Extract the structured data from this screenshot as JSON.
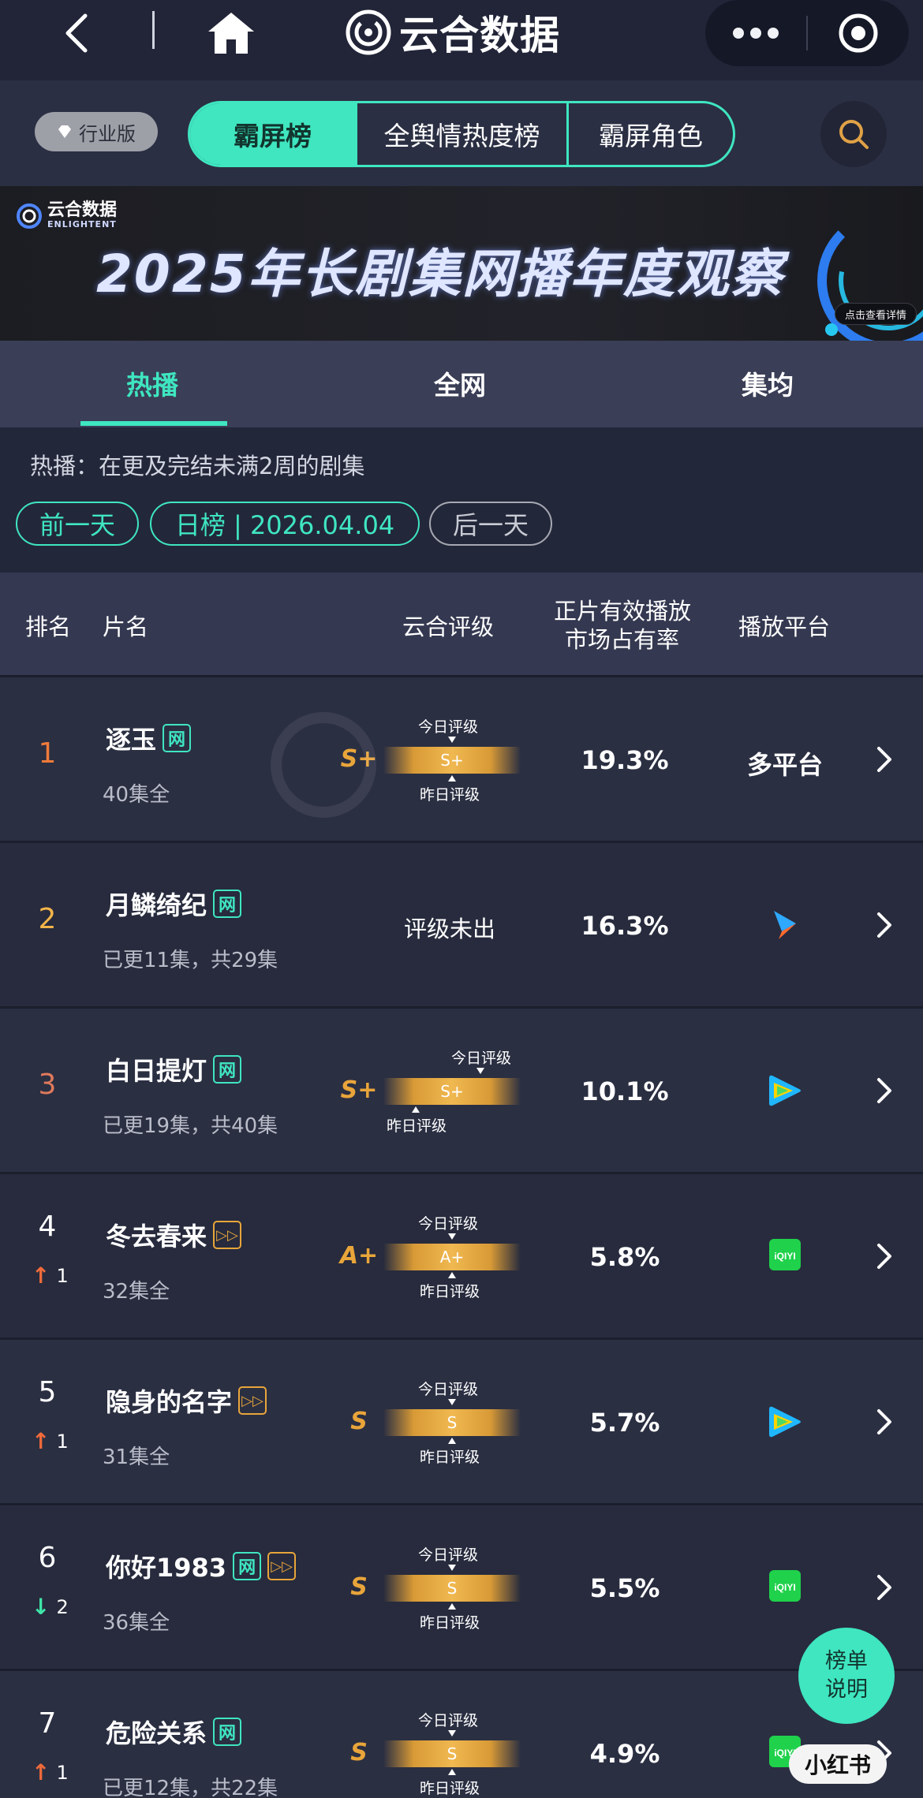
{
  "topbar": {
    "app_title": "云合数据"
  },
  "subnav": {
    "industry_badge": "行业版",
    "segments": [
      "霸屏榜",
      "全舆情热度榜",
      "霸屏角色"
    ],
    "active_segment": 0
  },
  "banner": {
    "logo_text": "云合数据",
    "logo_sub": "ENLIGHTENT",
    "headline": "2025年长剧集网播年度观察",
    "detail_button": "点击查看详情",
    "accent": "#2d7cf0"
  },
  "tabs": [
    "热播",
    "全网",
    "集均"
  ],
  "description": "热播：在更及完结未满2周的剧集",
  "date_nav": {
    "prev": "前一天",
    "current": "日榜 | 2026.04.04",
    "next": "后一天"
  },
  "table_headers": {
    "rank": "排名",
    "name": "片名",
    "grade": "云合评级",
    "share_line1": "正片有效播放",
    "share_line2": "市场占有率",
    "platform": "播放平台"
  },
  "grade_labels": {
    "today": "今日评级",
    "yesterday": "昨日评级"
  },
  "rows": [
    {
      "rank": "1",
      "rank_color": "#f07a3a",
      "title": "逐玉",
      "tag_net": "网",
      "tag_ff": "",
      "episodes": "40集全",
      "grade": "S+",
      "bar_grade": "S+",
      "share": "19.3%",
      "platform": "多平台",
      "platform_icon": "",
      "trend": "",
      "trend_dir": ""
    },
    {
      "rank": "2",
      "rank_color": "#f4b44a",
      "title": "月鳞绮纪",
      "tag_net": "网",
      "tag_ff": "",
      "episodes": "已更11集，共29集",
      "grade": "",
      "pending": "评级未出",
      "share": "16.3%",
      "platform": "",
      "platform_icon": "youku-icon",
      "trend": "",
      "trend_dir": ""
    },
    {
      "rank": "3",
      "rank_color": "#e07a5c",
      "title": "白日提灯",
      "tag_net": "网",
      "tag_ff": "",
      "episodes": "已更19集，共40集",
      "grade": "S+",
      "bar_grade": "S+",
      "share": "10.1%",
      "platform": "",
      "platform_icon": "tencent-video-icon",
      "trend": "",
      "trend_dir": ""
    },
    {
      "rank": "4",
      "rank_color": "#ffffff",
      "title": "冬去春来",
      "tag_net": "",
      "tag_ff": "ff",
      "episodes": "32集全",
      "grade": "A+",
      "bar_grade": "A+",
      "share": "5.8%",
      "platform": "",
      "platform_icon": "iqiyi-icon",
      "trend": "1",
      "trend_dir": "up"
    },
    {
      "rank": "5",
      "rank_color": "#ffffff",
      "title": "隐身的名字",
      "tag_net": "",
      "tag_ff": "ff",
      "episodes": "31集全",
      "grade": "S",
      "bar_grade": "S",
      "share": "5.7%",
      "platform": "",
      "platform_icon": "tencent-video-icon",
      "trend": "1",
      "trend_dir": "up"
    },
    {
      "rank": "6",
      "rank_color": "#ffffff",
      "title": "你好1983",
      "tag_net": "网",
      "tag_ff": "ff",
      "episodes": "36集全",
      "grade": "S",
      "bar_grade": "S",
      "share": "5.5%",
      "platform": "",
      "platform_icon": "iqiyi-icon",
      "trend": "2",
      "trend_dir": "down"
    },
    {
      "rank": "7",
      "rank_color": "#ffffff",
      "title": "危险关系",
      "tag_net": "网",
      "tag_ff": "",
      "episodes": "已更12集，共22集",
      "grade": "S",
      "bar_grade": "S",
      "share": "4.9%",
      "platform": "",
      "platform_icon": "iqiyi-icon",
      "trend": "1",
      "trend_dir": "up"
    }
  ],
  "help_button": [
    "榜单",
    "说明"
  ],
  "watermark_text": "小红书",
  "iqiyi_text": "iQIYI",
  "colors": {
    "accent": "#3fe6c0",
    "up": "#f06a3a",
    "down": "#3fe6a8",
    "grade": "#e9a53a"
  }
}
